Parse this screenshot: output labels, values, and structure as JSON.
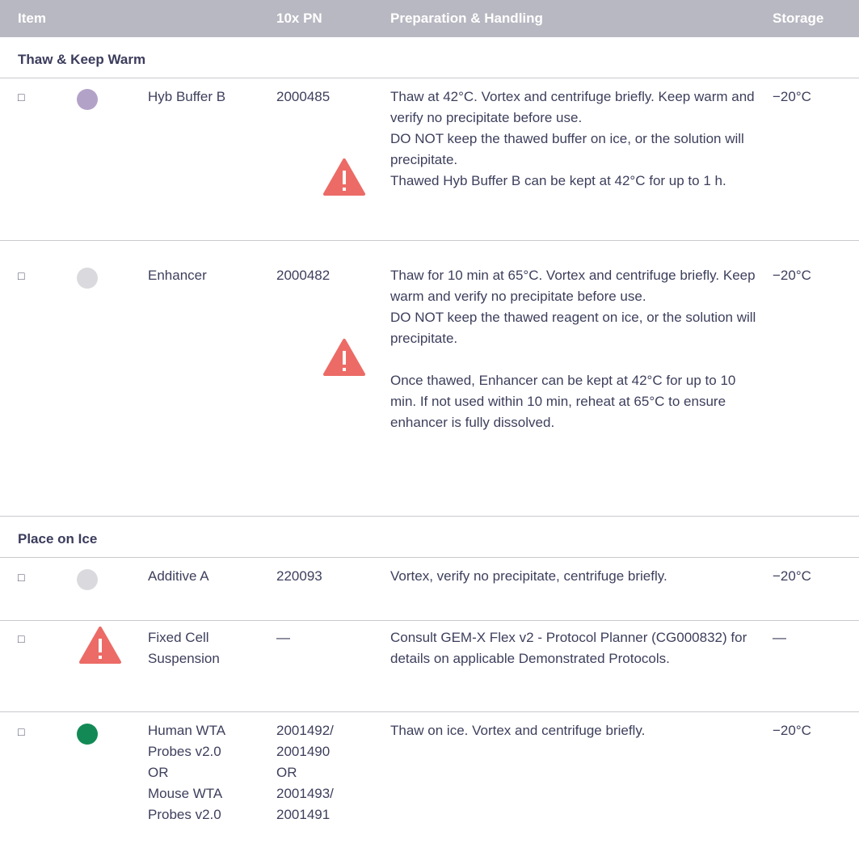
{
  "headers": {
    "item": "Item",
    "pn": "10x PN",
    "prep": "Preparation & Handling",
    "storage": "Storage"
  },
  "colors": {
    "header_bg": "#b8b8c2",
    "warning": "#ec6b66",
    "dot_purple": "#b3a2c8",
    "dot_gray": "#dadade",
    "dot_green": "#138a55"
  },
  "sections": {
    "thaw": "Thaw & Keep Warm",
    "ice": "Place on Ice"
  },
  "checkbox_glyph": "□",
  "rows": [
    {
      "name": "Hyb Buffer B",
      "pn": "2000485",
      "prep": [
        "Thaw at 42°C. Vortex and centrifuge briefly. Keep warm and verify no precipitate before use.",
        "DO NOT keep the thawed buffer on ice, or the solution will precipitate.",
        "Thawed Hyb Buffer B can be kept at 42°C for up to 1 h."
      ],
      "storage": "−20°C",
      "dot": "purple",
      "icon": "warning-icon"
    },
    {
      "name": "Enhancer",
      "pn": "2000482",
      "prep": [
        "Thaw for 10 min at 65°C. Vortex and centrifuge briefly. Keep warm and verify no precipitate before use.",
        "DO NOT keep the thawed reagent on ice, or the solution will precipitate.",
        "Once thawed, Enhancer can be kept at 42°C for up to 10 min. If not used within 10 min, reheat at 65°C to ensure enhancer is fully dissolved."
      ],
      "storage": "−20°C",
      "dot": "gray",
      "icon": "warning-icon"
    },
    {
      "name": "Additive A",
      "pn": "220093",
      "prep": [
        "Vortex, verify no precipitate, centrifuge briefly."
      ],
      "storage": "−20°C",
      "dot": "gray"
    },
    {
      "name": "Fixed Cell Suspension",
      "pn": "—",
      "prep": [
        "Consult GEM-X Flex v2 - Protocol Planner (CG000832) for details on applicable Demonstrated Protocols."
      ],
      "storage": "—",
      "icon": "warning-icon"
    },
    {
      "name_lines": [
        "Human WTA",
        "Probes v2.0",
        "OR",
        "Mouse WTA",
        "Probes v2.0"
      ],
      "pn_lines": [
        "2001492/",
        "2001490",
        "OR",
        "2001493/",
        "2001491"
      ],
      "prep": [
        "Thaw on ice. Vortex and centrifuge briefly."
      ],
      "storage": "−20°C",
      "dot": "green"
    }
  ]
}
